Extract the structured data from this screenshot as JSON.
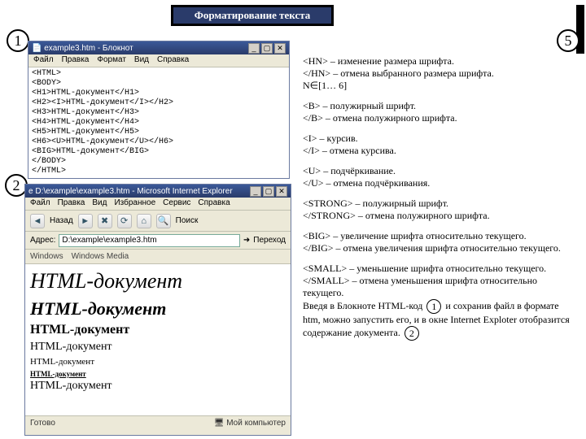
{
  "title": "Форматирование текста",
  "badges": {
    "one": "1",
    "two": "2",
    "five": "5"
  },
  "notepad": {
    "title": "example3.htm - Блокнот",
    "menu": [
      "Файл",
      "Правка",
      "Формат",
      "Вид",
      "Справка"
    ],
    "code": "<HTML>\n<BODY>\n<H1>HTML-документ</H1>\n<H2><I>HTML-документ</I></H2>\n<H3>HTML-документ</H3>\n<H4>HTML-документ</H4>\n<H5>HTML-документ</H5>\n<H6><U>HTML-документ</U></H6>\n<BIG>HTML-документ</BIG>\n</BODY>\n</HTML>"
  },
  "ie": {
    "title": "D:\\example\\example3.htm - Microsoft Internet Explorer",
    "menu": [
      "Файл",
      "Правка",
      "Вид",
      "Избранное",
      "Сервис",
      "Справка"
    ],
    "back": "Назад",
    "search": "Поиск",
    "addr_label": "Адрес:",
    "addr_value": "D:\\example\\example3.htm",
    "go": "Переход",
    "links": [
      "Windows",
      "Windows Media"
    ],
    "h1": "HTML-документ",
    "h2": "HTML-документ",
    "h3": "HTML-документ",
    "h4": "HTML-документ",
    "h5": "HTML-документ",
    "h6": "HTML-документ",
    "big": "HTML-документ",
    "status_done": "Готово",
    "status_zone": "Мой компьютер"
  },
  "txt": {
    "hn1": "<HN> – изменение размера шрифта.",
    "hn2": "</HN> – отмена выбранного размера шрифта.",
    "hn3": "N∈[1… 6]",
    "b1": "<B> – полужирный шрифт.",
    "b2": "</B> – отмена полужирного шрифта.",
    "i1": "<I> – курсив.",
    "i2": "</I> – отмена курсива.",
    "u1": "<U> – подчёркивание.",
    "u2": "</U> – отмена подчёркивания.",
    "s1": "<STRONG> – полужирный шрифт.",
    "s2": "</STRONG> –  отмена полужирного шрифта.",
    "big1": "<BIG> – увеличение шрифта  относительно текущего.",
    "big2": "</BIG> – отмена увеличения шрифта  относительно текущего.",
    "sm1": "<SMALL> – уменьшение шрифта относительно текущего.",
    "sm2": "</SMALL> – отмена уменьшения шрифта  относительно текущего.",
    "fin1a": "Введя в Блокноте HTML-код",
    "fin1b": "и сохранив файл в формате htm, можно запустить его, и в окне Internet Exploter отобразится содержание документа.",
    "inline1": "1",
    "inline2": "2"
  }
}
